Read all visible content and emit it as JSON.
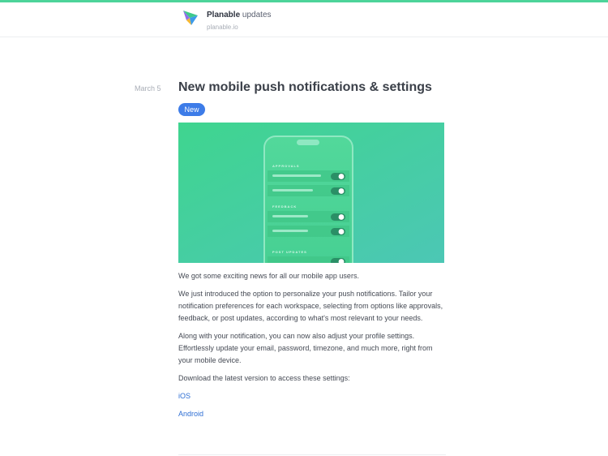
{
  "header": {
    "brand_name": "Planable",
    "brand_suffix": "updates",
    "domain": "planable.io",
    "accent_color": "#4dd49a"
  },
  "post": {
    "date": "March 5",
    "title": "New mobile push notifications & settings",
    "badge": "New",
    "badge_color": "#3d7ce8",
    "illustration": {
      "section_labels": [
        "APPROVALS",
        "FEEDBACK",
        "POST UPDATES"
      ]
    },
    "paragraphs": [
      "We got some exciting news for all our mobile app users.",
      "We just introduced the option to personalize your push notifications. Tailor your notification preferences for each workspace, selecting from options like approvals, feedback, or post updates, according to what's most relevant to your needs.",
      "Along with your notification, you can now also adjust your profile settings. Effortlessly update your email, password, timezone, and much more, right from your mobile device.",
      "Download the latest version to access these settings:"
    ],
    "links": [
      "iOS",
      "Android"
    ]
  }
}
